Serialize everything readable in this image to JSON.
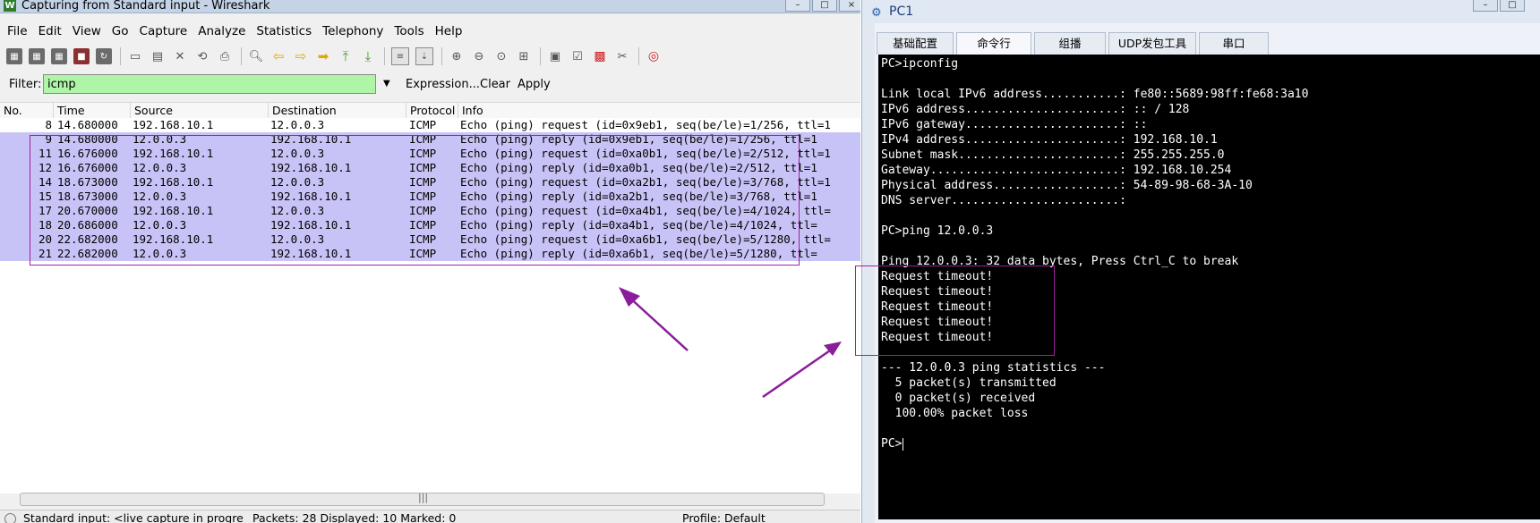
{
  "wireshark": {
    "title": "Capturing from Standard input - Wireshark",
    "menu": [
      "File",
      "Edit",
      "View",
      "Go",
      "Capture",
      "Analyze",
      "Statistics",
      "Telephony",
      "Tools",
      "Help"
    ],
    "filter": {
      "label": "Filter:",
      "value": "icmp",
      "expression": "Expression...",
      "clear": "Clear",
      "apply": "Apply"
    },
    "columns": [
      "No.",
      "Time",
      "Source",
      "Destination",
      "Protocol",
      "Info"
    ],
    "packets": [
      {
        "no": "8",
        "time": "14.680000",
        "src": "192.168.10.1",
        "dst": "12.0.0.3",
        "proto": "ICMP",
        "info": "Echo (ping) request  (id=0x9eb1, seq(be/le)=1/256, ttl=1"
      },
      {
        "no": "9",
        "time": "14.680000",
        "src": "12.0.0.3",
        "dst": "192.168.10.1",
        "proto": "ICMP",
        "info": "Echo (ping) reply    (id=0x9eb1, seq(be/le)=1/256, ttl=1"
      },
      {
        "no": "11",
        "time": "16.676000",
        "src": "192.168.10.1",
        "dst": "12.0.0.3",
        "proto": "ICMP",
        "info": "Echo (ping) request  (id=0xa0b1, seq(be/le)=2/512, ttl=1"
      },
      {
        "no": "12",
        "time": "16.676000",
        "src": "12.0.0.3",
        "dst": "192.168.10.1",
        "proto": "ICMP",
        "info": "Echo (ping) reply    (id=0xa0b1, seq(be/le)=2/512, ttl=1"
      },
      {
        "no": "14",
        "time": "18.673000",
        "src": "192.168.10.1",
        "dst": "12.0.0.3",
        "proto": "ICMP",
        "info": "Echo (ping) request  (id=0xa2b1, seq(be/le)=3/768, ttl=1"
      },
      {
        "no": "15",
        "time": "18.673000",
        "src": "12.0.0.3",
        "dst": "192.168.10.1",
        "proto": "ICMP",
        "info": "Echo (ping) reply    (id=0xa2b1, seq(be/le)=3/768, ttl=1"
      },
      {
        "no": "17",
        "time": "20.670000",
        "src": "192.168.10.1",
        "dst": "12.0.0.3",
        "proto": "ICMP",
        "info": "Echo (ping) request  (id=0xa4b1, seq(be/le)=4/1024, ttl="
      },
      {
        "no": "18",
        "time": "20.686000",
        "src": "12.0.0.3",
        "dst": "192.168.10.1",
        "proto": "ICMP",
        "info": "Echo (ping) reply    (id=0xa4b1, seq(be/le)=4/1024, ttl="
      },
      {
        "no": "20",
        "time": "22.682000",
        "src": "192.168.10.1",
        "dst": "12.0.0.3",
        "proto": "ICMP",
        "info": "Echo (ping) request  (id=0xa6b1, seq(be/le)=5/1280, ttl="
      },
      {
        "no": "21",
        "time": "22.682000",
        "src": "12.0.0.3",
        "dst": "192.168.10.1",
        "proto": "ICMP",
        "info": "Echo (ping) reply    (id=0xa6b1, seq(be/le)=5/1280, ttl="
      }
    ],
    "status": {
      "left": "Standard input: <live capture in progre",
      "mid": "Packets: 28 Displayed: 10 Marked: 0",
      "right": "Profile: Default"
    },
    "colors": {
      "filter_bg": "#aef5a8",
      "highlight_row": "#c8c3f6",
      "annotation": "#a020a0"
    }
  },
  "pc": {
    "title": "PC1",
    "tabs": [
      "基础配置",
      "命令行",
      "组播",
      "UDP发包工具",
      "串口"
    ],
    "active_tab": "命令行",
    "terminal": [
      "PC>ipconfig",
      "",
      "Link local IPv6 address...........: fe80::5689:98ff:fe68:3a10",
      "IPv6 address......................: :: / 128",
      "IPv6 gateway......................: ::",
      "IPv4 address......................: 192.168.10.1",
      "Subnet mask.......................: 255.255.255.0",
      "Gateway...........................: 192.168.10.254",
      "Physical address..................: 54-89-98-68-3A-10",
      "DNS server........................:",
      "",
      "PC>ping 12.0.0.3",
      "",
      "Ping 12.0.0.3: 32 data bytes, Press Ctrl_C to break",
      "Request timeout!",
      "Request timeout!",
      "Request timeout!",
      "Request timeout!",
      "Request timeout!",
      "",
      "--- 12.0.0.3 ping statistics ---",
      "  5 packet(s) transmitted",
      "  0 packet(s) received",
      "  100.00% packet loss",
      "",
      "PC>"
    ]
  }
}
